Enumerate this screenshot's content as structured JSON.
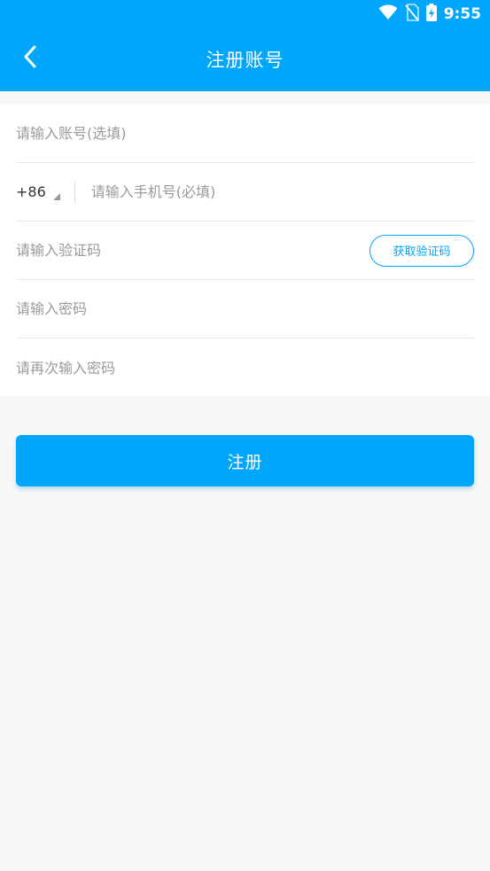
{
  "status_bar": {
    "time": "9:55",
    "icons": [
      "wifi-icon",
      "no-sim-icon",
      "battery-charging-icon"
    ]
  },
  "nav": {
    "back_icon": "chevron-left-icon",
    "title": "注册账号"
  },
  "form": {
    "account": {
      "placeholder": "请输入账号(选填)",
      "value": ""
    },
    "phone": {
      "country_code": "+86",
      "placeholder": "请输入手机号(必填)",
      "value": ""
    },
    "verification": {
      "placeholder": "请输入验证码",
      "value": "",
      "button_label": "获取验证码"
    },
    "password": {
      "placeholder": "请输入密码",
      "value": ""
    },
    "confirm_password": {
      "placeholder": "请再次输入密码",
      "value": ""
    }
  },
  "register_button": {
    "label": "注册"
  },
  "colors": {
    "primary": "#00a6fb",
    "background": "#f7f7f8",
    "placeholder": "#9a9a9a"
  }
}
